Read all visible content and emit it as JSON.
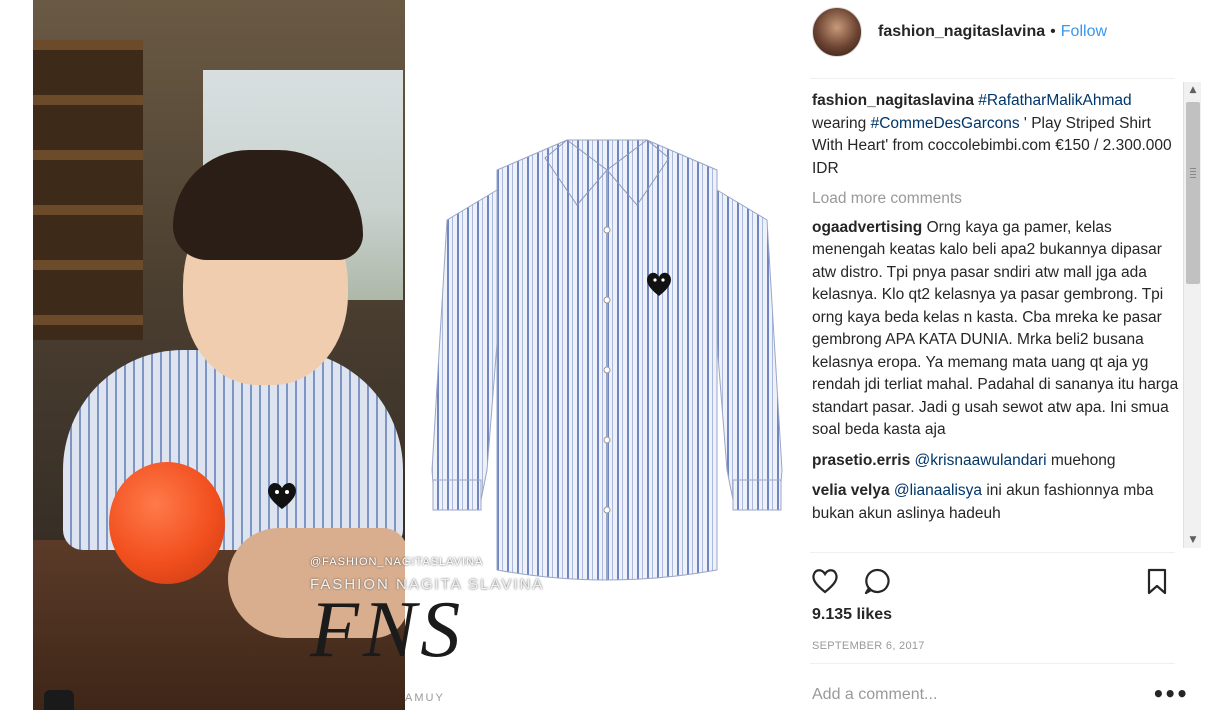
{
  "post": {
    "username": "fashion_nagitaslavina",
    "separator": "•",
    "follow_label": "Follow",
    "caption": {
      "username": "fashion_nagitaslavina",
      "tag1": "#RafatharMalikAhmad",
      "text1": " wearing ",
      "tag2": "#CommeDesGarcons",
      "text2": " ' Play Striped Shirt With Heart' from coccolebimbi.com €150 / 2.300.000 IDR"
    },
    "load_more_label": "Load more comments",
    "comments": [
      {
        "username": "ogaadvertising",
        "text": "Orng kaya ga pamer, kelas menengah keatas kalo beli apa2 bukannya dipasar atw distro. Tpi pnya pasar sndiri atw mall jga ada kelasnya. Klo qt2 kelasnya ya pasar gembrong. Tpi orng kaya beda kelas n kasta. Cba mreka ke pasar gembrong APA KATA DUNIA. Mrka beli2 busana kelasnya eropa. Ya memang mata uang qt aja yg rendah jdi terliat mahal. Padahal di sananya itu harga standart pasar. Jadi g usah sewot atw apa. Ini smua soal beda kasta aja"
      },
      {
        "username": "prasetio.erris",
        "mention": "@krisnaawulandari",
        "text": "muehong"
      },
      {
        "username": "velia velya",
        "mention": "@lianaalisya",
        "text": "ini akun fashionnya mba bukan akun aslinya hadeuh"
      }
    ],
    "likes": "9.135 likes",
    "date": "SEPTEMBER 6, 2017",
    "add_comment_placeholder": "Add a comment...",
    "more_label": "•••"
  },
  "watermark": {
    "handle": "@FASHION_NAGITASLAVINA",
    "name": "FASHION NAGITA SLAVINA",
    "monogram": "FNS",
    "footer": "AMUY"
  },
  "icons": {
    "like": "heart-outline-icon",
    "comment": "speech-bubble-icon",
    "save": "bookmark-icon",
    "more": "ellipsis-icon",
    "scroll_up": "chevron-up-icon",
    "scroll_down": "chevron-down-icon"
  },
  "colors": {
    "link": "#3897f0",
    "hashtag": "#003569",
    "muted": "#999999",
    "text": "#262626"
  }
}
